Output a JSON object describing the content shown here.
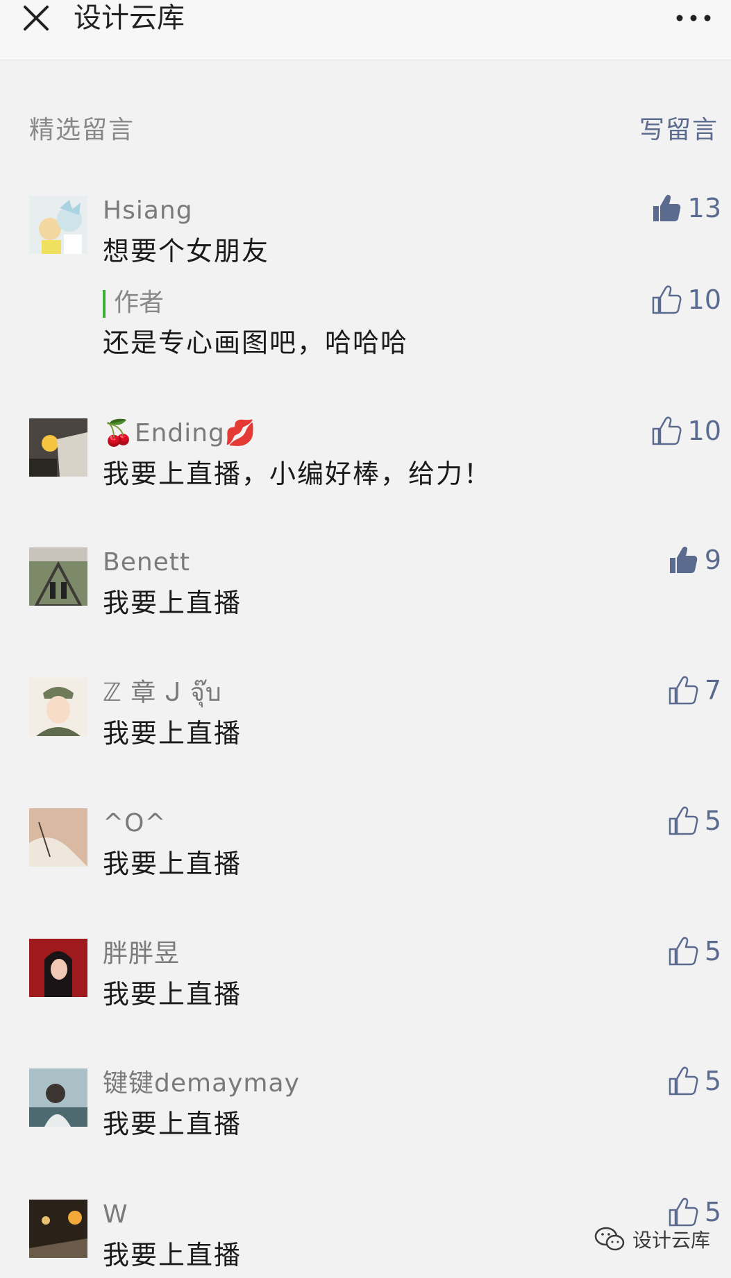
{
  "header": {
    "title": "设计云库",
    "close_icon": "close-icon",
    "more_icon": "more-dots-icon"
  },
  "section": {
    "title": "精选留言",
    "write_label": "写留言"
  },
  "comments": [
    {
      "nickname": "Hsiang",
      "text": "想要个女朋友",
      "likes": "13",
      "liked": true,
      "reply": {
        "label": "作者",
        "text": "还是专心画图吧，哈哈哈",
        "likes": "10",
        "liked": false
      }
    },
    {
      "nickname": "🍒Ending💋",
      "text": "我要上直播，小编好棒，给力！",
      "likes": "10",
      "liked": false
    },
    {
      "nickname": "Benett",
      "text": "我要上直播",
      "likes": "9",
      "liked": true
    },
    {
      "nickname": "ℤ 章 ᒍ จุ๊บ",
      "text": "我要上直播",
      "likes": "7",
      "liked": false
    },
    {
      "nickname": "^O^",
      "text": "我要上直播",
      "likes": "5",
      "liked": false
    },
    {
      "nickname": "胖胖昱",
      "text": "我要上直播",
      "likes": "5",
      "liked": false
    },
    {
      "nickname": "键键demaymay",
      "text": "我要上直播",
      "likes": "5",
      "liked": false
    },
    {
      "nickname": "W",
      "text": "我要上直播",
      "likes": "5",
      "liked": false
    }
  ],
  "watermark": {
    "text": "设计云库",
    "icon": "wechat-icon"
  },
  "colors": {
    "background": "#f2f2f2",
    "link": "#5b6b8f",
    "author_bar": "#3cb034",
    "nickname": "#7a7a7a"
  }
}
